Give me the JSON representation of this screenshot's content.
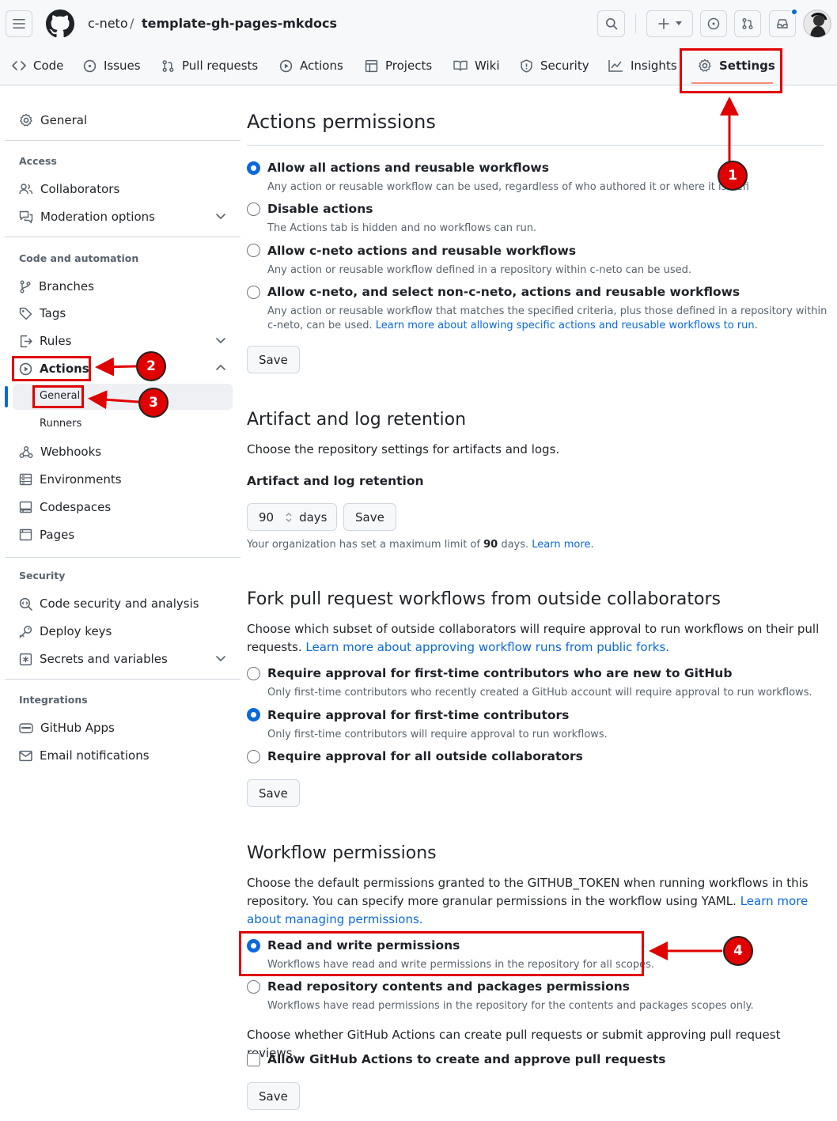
{
  "header": {
    "owner": "c-neto",
    "separator": "/",
    "repo": "template-gh-pages-mkdocs"
  },
  "tabs": [
    {
      "label": "Code",
      "icon": "code-icon"
    },
    {
      "label": "Issues",
      "icon": "issue-icon"
    },
    {
      "label": "Pull requests",
      "icon": "pull-request-icon"
    },
    {
      "label": "Actions",
      "icon": "play-icon"
    },
    {
      "label": "Projects",
      "icon": "table-icon"
    },
    {
      "label": "Wiki",
      "icon": "book-icon"
    },
    {
      "label": "Security",
      "icon": "shield-icon"
    },
    {
      "label": "Insights",
      "icon": "graph-icon"
    },
    {
      "label": "Settings",
      "icon": "gear-icon"
    }
  ],
  "sidebar": {
    "general": "General",
    "access_head": "Access",
    "collaborators": "Collaborators",
    "moderation": "Moderation options",
    "code_auto_head": "Code and automation",
    "branches": "Branches",
    "tags": "Tags",
    "rules": "Rules",
    "actions": "Actions",
    "actions_general": "General",
    "runners": "Runners",
    "webhooks": "Webhooks",
    "environments": "Environments",
    "codespaces": "Codespaces",
    "pages": "Pages",
    "security_head": "Security",
    "code_security": "Code security and analysis",
    "deploy_keys": "Deploy keys",
    "secrets": "Secrets and variables",
    "integrations_head": "Integrations",
    "github_apps": "GitHub Apps",
    "email_notifications": "Email notifications"
  },
  "actions_permissions": {
    "title": "Actions permissions",
    "options": [
      {
        "label": "Allow all actions and reusable workflows",
        "desc": "Any action or reusable workflow can be used, regardless of who authored it or where it is defi",
        "checked": true
      },
      {
        "label": "Disable actions",
        "desc": "The Actions tab is hidden and no workflows can run.",
        "checked": false
      },
      {
        "label": "Allow c-neto actions and reusable workflows",
        "desc": "Any action or reusable workflow defined in a repository within c-neto can be used.",
        "checked": false
      },
      {
        "label": "Allow c-neto, and select non-c-neto, actions and reusable workflows",
        "desc": "Any action or reusable workflow that matches the specified criteria, plus those defined in a repository within",
        "desc2": "c-neto, can be used.",
        "desc2_link": "Learn more about allowing specific actions and reusable workflows to run.",
        "checked": false
      }
    ],
    "save": "Save"
  },
  "artifact": {
    "title": "Artifact and log retention",
    "desc": "Choose the repository settings for artifacts and logs.",
    "subhead": "Artifact and log retention",
    "days_value": "90",
    "days_unit": "days",
    "save": "Save",
    "note_prefix": "Your organization has set a maximum limit of",
    "note_value": "90",
    "note_suffix": "days.",
    "note_link": "Learn more."
  },
  "fork": {
    "title": "Fork pull request workflows from outside collaborators",
    "desc": "Choose which subset of outside collaborators will require approval to run workflows on their pull requests.",
    "desc_link": "Learn more about approving workflow runs from public forks.",
    "options": [
      {
        "label": "Require approval for first-time contributors who are new to GitHub",
        "desc": "Only first-time contributors who recently created a GitHub account will require approval to run workflows.",
        "checked": false
      },
      {
        "label": "Require approval for first-time contributors",
        "desc": "Only first-time contributors will require approval to run workflows.",
        "checked": true
      },
      {
        "label": "Require approval for all outside collaborators",
        "desc": "",
        "checked": false
      }
    ],
    "save": "Save"
  },
  "workflow": {
    "title": "Workflow permissions",
    "desc": "Choose the default permissions granted to the GITHUB_TOKEN when running workflows in this repository. You can specify more granular permissions in the workflow using YAML.",
    "desc_link": "Learn more about managing permissions.",
    "options": [
      {
        "label": "Read and write permissions",
        "desc": "Workflows have read and write permissions in the repository for all scopes.",
        "checked": true
      },
      {
        "label": "Read repository contents and packages permissions",
        "desc": "Workflows have read permissions in the repository for the contents and packages scopes only.",
        "checked": false
      }
    ],
    "pr_desc": "Choose whether GitHub Actions can create pull requests or submit approving pull request reviews.",
    "pr_checkbox": "Allow GitHub Actions to create and approve pull requests",
    "pr_checked": false,
    "save": "Save"
  },
  "annotations": {
    "badges": [
      "1",
      "2",
      "3",
      "4"
    ],
    "color": "#e00000"
  },
  "colors": {
    "accent": "#0969da",
    "selected_tab_underline": "#fd8c73",
    "text": "#1f2328",
    "muted": "#59636e"
  }
}
